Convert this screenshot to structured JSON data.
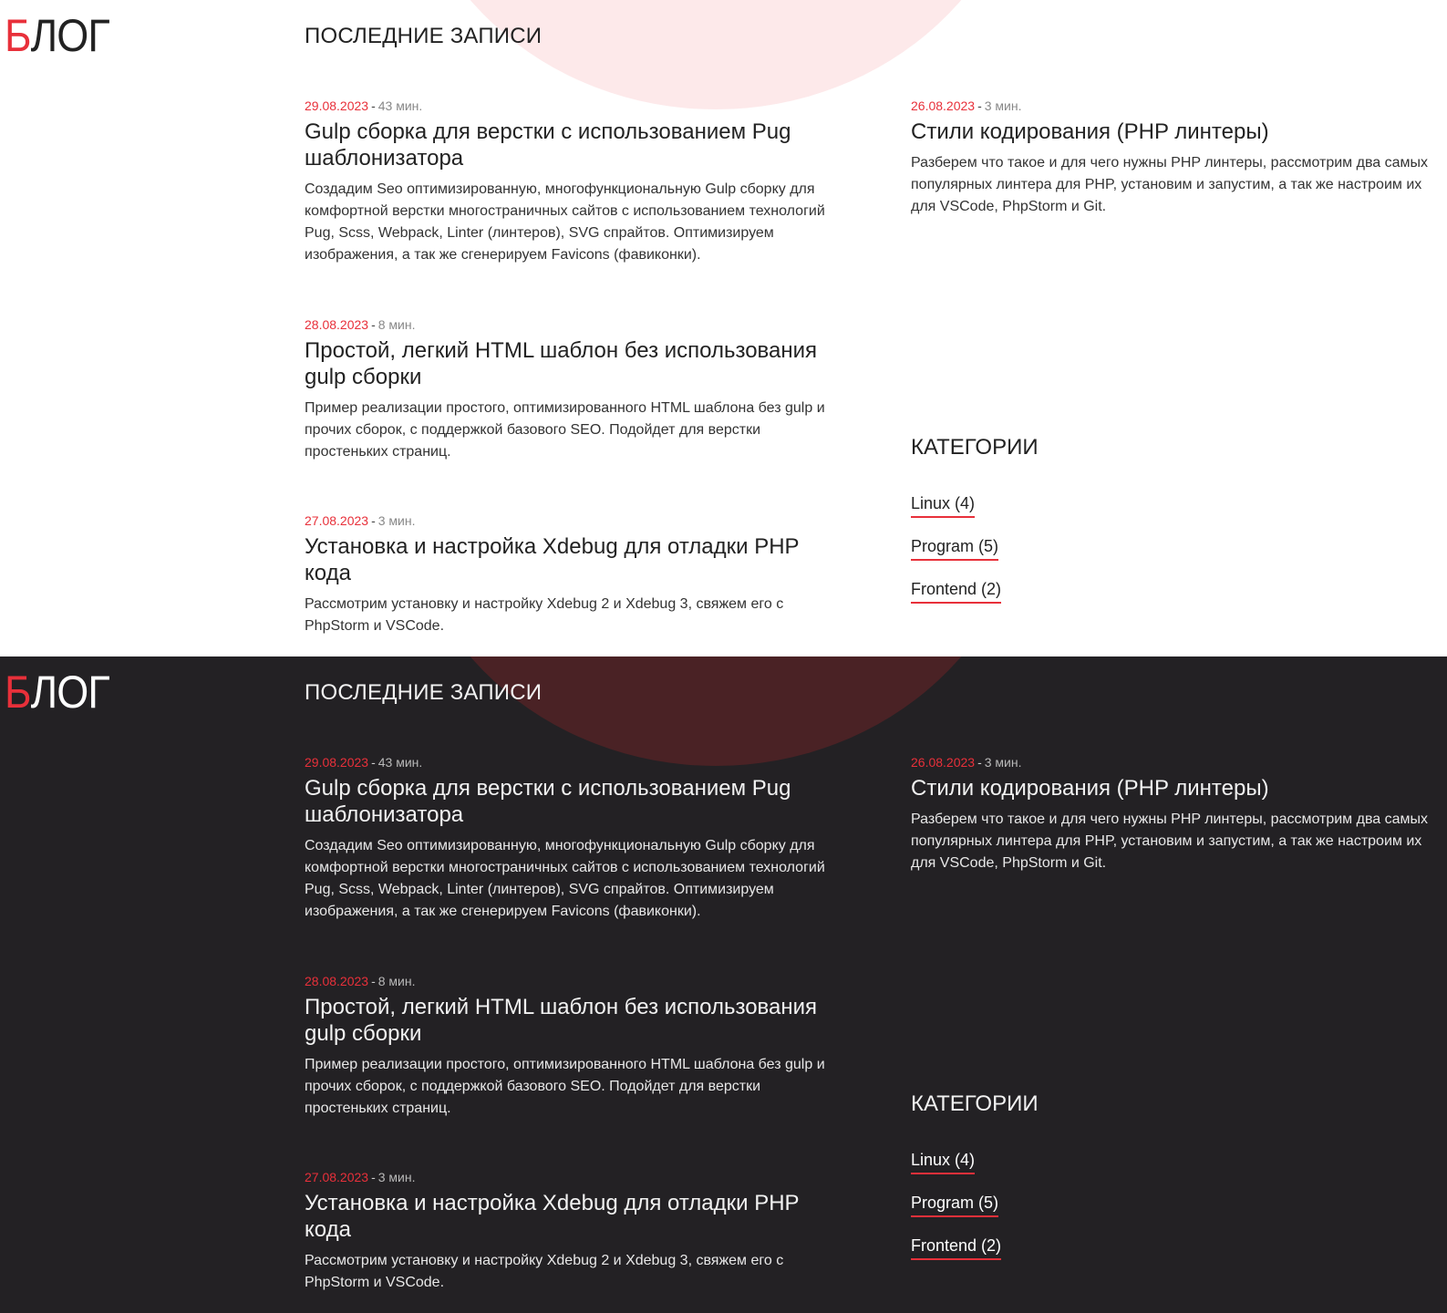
{
  "logo": {
    "first_letter": "Б",
    "rest": "ЛОГ"
  },
  "recent_title": "ПОСЛЕДНИЕ ЗАПИСИ",
  "posts": [
    {
      "date": "29.08.2023",
      "separator": "-",
      "duration": "43 мин.",
      "title": "Gulp сборка для верстки с использованием Pug шаблонизатора",
      "description": "Создадим Seo оптимизированную, многофункциональную Gulp сборку для комфортной верстки многостраничных сайтов с использованием технологий Pug, Scss, Webpack, Linter (линтеров), SVG спрайтов. Оптимизируем изображения, а так же сгенерируем Favicons (фавиконки)."
    },
    {
      "date": "28.08.2023",
      "separator": "-",
      "duration": "8 мин.",
      "title": "Простой, легкий HTML шаблон без использования gulp сборки",
      "description": "Пример реализации простого, оптимизированного HTML шаблона без gulp и прочих сборок, с поддержкой базового SEO. Подойдет для верстки простеньких страниц."
    },
    {
      "date": "27.08.2023",
      "separator": "-",
      "duration": "3 мин.",
      "title": "Установка и настройка Xdebug для отладки PHP кода",
      "description": "Рассмотрим установку и настройку Xdebug 2 и Xdebug 3, свяжем его с PhpStorm и VSCode."
    },
    {
      "date": "26.08.2023",
      "separator": "-",
      "duration": "3 мин.",
      "title": "Стили кодирования (PHP линтеры)",
      "description": "Разберем что такое и для чего нужны PHP линтеры, рассмотрим два самых популярных линтера для PHP, установим и запустим, а так же настроим их для VSCode, PhpStorm и Git."
    }
  ],
  "categories_title": "КАТЕГОРИИ",
  "categories": [
    {
      "label": "Linux (4)"
    },
    {
      "label": "Program (5)"
    },
    {
      "label": "Frontend (2)"
    }
  ],
  "colors": {
    "accent": "#e8303a",
    "light_bg": "#ffffff",
    "dark_bg": "#232124",
    "light_blob": "#fde9ea",
    "dark_blob": "#4a2225"
  }
}
